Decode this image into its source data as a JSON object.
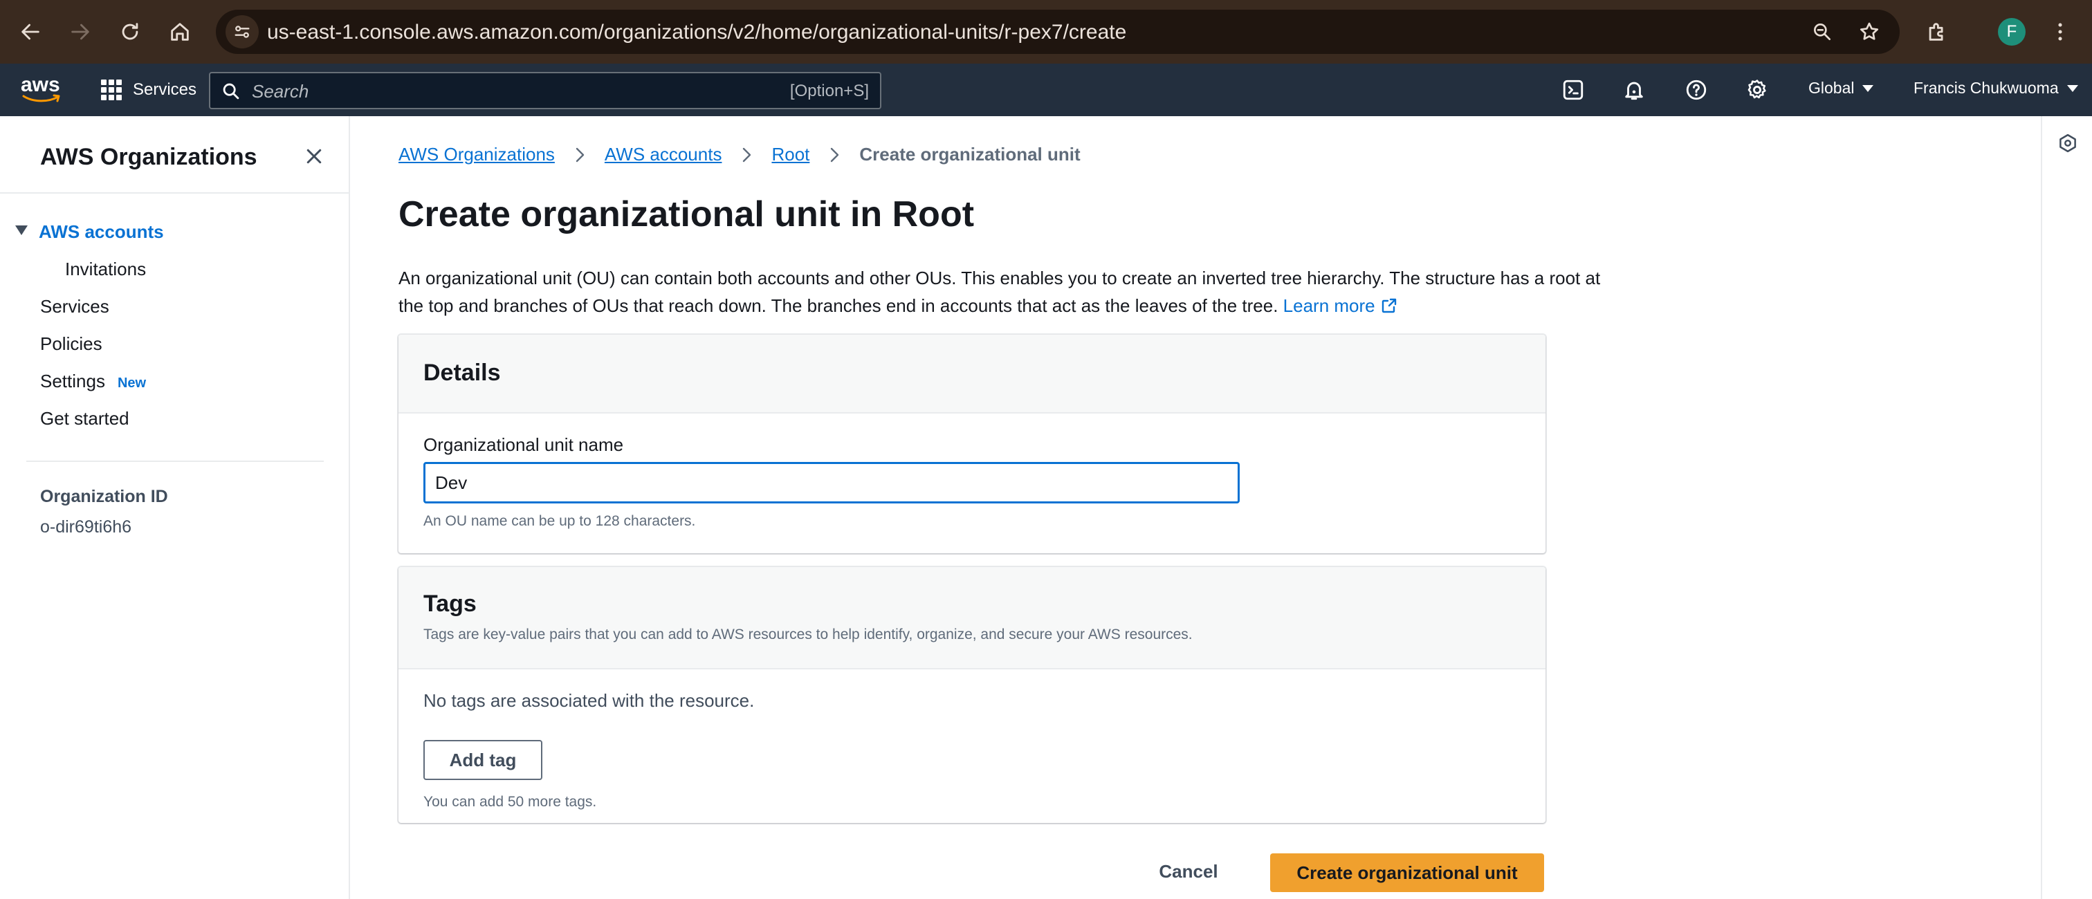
{
  "browser": {
    "url": "us-east-1.console.aws.amazon.com/organizations/v2/home/organizational-units/r-pex7/create",
    "avatar_letter": "F",
    "icons": [
      "back-icon",
      "forward-icon",
      "reload-icon",
      "home-icon",
      "site-settings-icon",
      "zoom-icon",
      "bookmark-star-icon",
      "extensions-icon",
      "avatar",
      "more-vert-icon"
    ]
  },
  "aws_nav": {
    "logo_text": "aws",
    "services_label": "Services",
    "search_placeholder": "Search",
    "search_shortcut": "[Option+S]",
    "region_label": "Global",
    "user_label": "Francis Chukwuoma",
    "icons": [
      "cloudshell-icon",
      "notifications-icon",
      "help-icon",
      "settings-icon"
    ]
  },
  "sidebar": {
    "title": "AWS Organizations",
    "items": [
      {
        "label": "AWS accounts",
        "active": true
      },
      {
        "label": "Invitations"
      },
      {
        "label": "Services"
      },
      {
        "label": "Policies"
      },
      {
        "label": "Settings",
        "badge": "New"
      },
      {
        "label": "Get started"
      }
    ],
    "org_id_label": "Organization ID",
    "org_id_value": "o-dir69ti6h6"
  },
  "breadcrumb": [
    {
      "label": "AWS Organizations",
      "link": true
    },
    {
      "label": "AWS accounts",
      "link": true
    },
    {
      "label": "Root",
      "link": true
    },
    {
      "label": "Create organizational unit",
      "link": false
    }
  ],
  "page": {
    "title": "Create organizational unit in Root",
    "description": "An organizational unit (OU) can contain both accounts and other OUs. This enables you to create an inverted tree hierarchy. The structure has a root at the top and branches of OUs that reach down. The branches end in accounts that act as the leaves of the tree.",
    "learn_more": "Learn more"
  },
  "details": {
    "title": "Details",
    "field_label": "Organizational unit name",
    "field_value": "Dev",
    "field_hint": "An OU name can be up to 128 characters."
  },
  "tags": {
    "title": "Tags",
    "subtitle": "Tags are key-value pairs that you can add to AWS resources to help identify, organize, and secure your AWS resources.",
    "empty_text": "No tags are associated with the resource.",
    "add_button": "Add tag",
    "remaining_hint": "You can add 50 more tags."
  },
  "actions": {
    "cancel": "Cancel",
    "submit": "Create organizational unit"
  },
  "colors": {
    "link": "#0972d3",
    "primary_button": "#f0a02e",
    "aws_nav_bg": "#232f3e",
    "browser_bg": "#3a2a1f"
  }
}
